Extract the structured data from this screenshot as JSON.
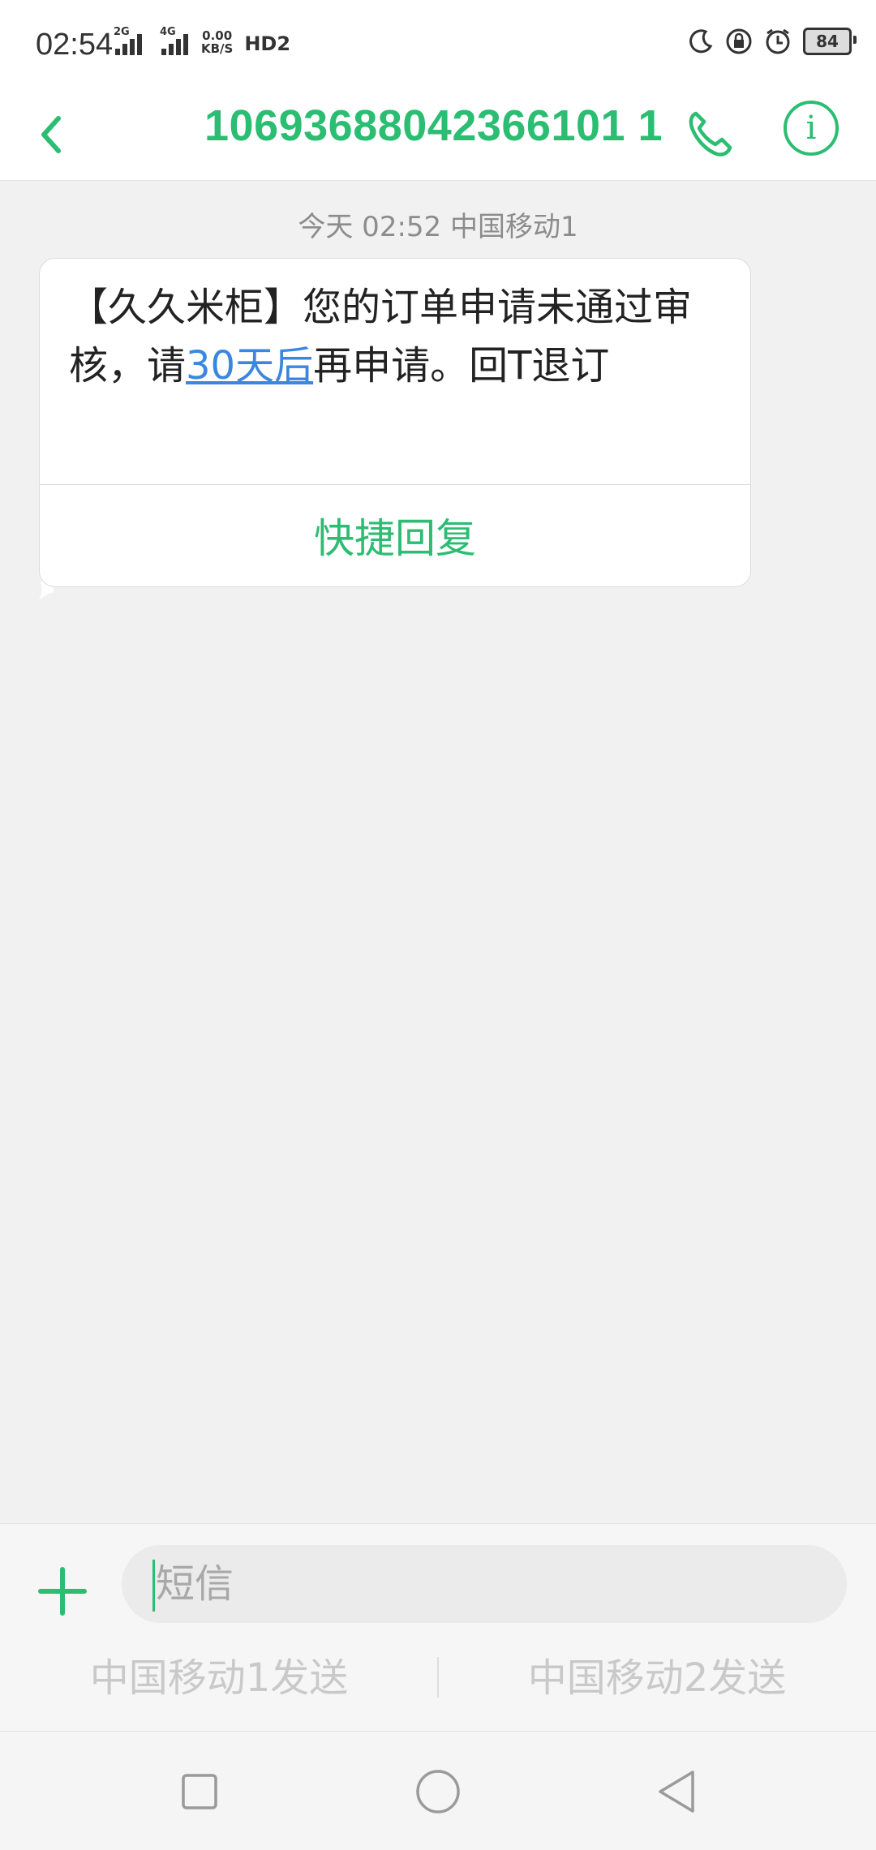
{
  "status_bar": {
    "time": "02:54",
    "sim1_label": "2G",
    "sim2_label": "4G",
    "speed_value": "0.00",
    "speed_unit": "KB/S",
    "hd_label": "HD2",
    "battery": "84",
    "icons": [
      "moon-icon",
      "lock-rotation-icon",
      "alarm-icon",
      "battery-icon"
    ]
  },
  "header": {
    "title": "10693688042366101 1",
    "back_icon": "chevron-left-icon",
    "call_icon": "phone-icon",
    "info_icon": "info-icon",
    "info_glyph": "i"
  },
  "conversation": {
    "timestamp": "今天 02:52  中国移动1",
    "message": {
      "text_before": "【久久米柜】您的订单申请未通过审核，请",
      "link_text": "30天后",
      "text_after": "再申请。回T退订"
    },
    "quick_reply_label": "快捷回复"
  },
  "composer": {
    "add_icon": "plus-icon",
    "placeholder": "短信",
    "send_sim1_label": "中国移动1发送",
    "send_sim2_label": "中国移动2发送"
  },
  "nav_bar": {
    "icons": [
      "square-recents-icon",
      "circle-home-icon",
      "triangle-back-icon"
    ]
  },
  "colors": {
    "accent": "#2bbd72",
    "link": "#3a87e0",
    "background": "#f1f1f1"
  }
}
